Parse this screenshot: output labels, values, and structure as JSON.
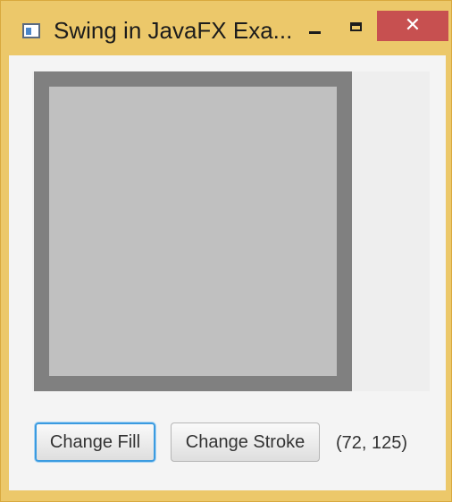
{
  "window": {
    "title": "Swing in JavaFX Exa...",
    "icons": {
      "app": "app-window-icon",
      "minimize": "minimize-icon",
      "maximize": "maximize-icon",
      "close": "close-icon"
    },
    "close_glyph": "✕",
    "colors": {
      "frame": "#ecc86a",
      "close": "#c75050"
    }
  },
  "canvas": {
    "fill_color": "#c0c0c0",
    "stroke_color": "#808080",
    "panel_color": "#eeeeee"
  },
  "controls": {
    "change_fill_label": "Change Fill",
    "change_stroke_label": "Change Stroke",
    "coordinates": "(72, 125)"
  }
}
